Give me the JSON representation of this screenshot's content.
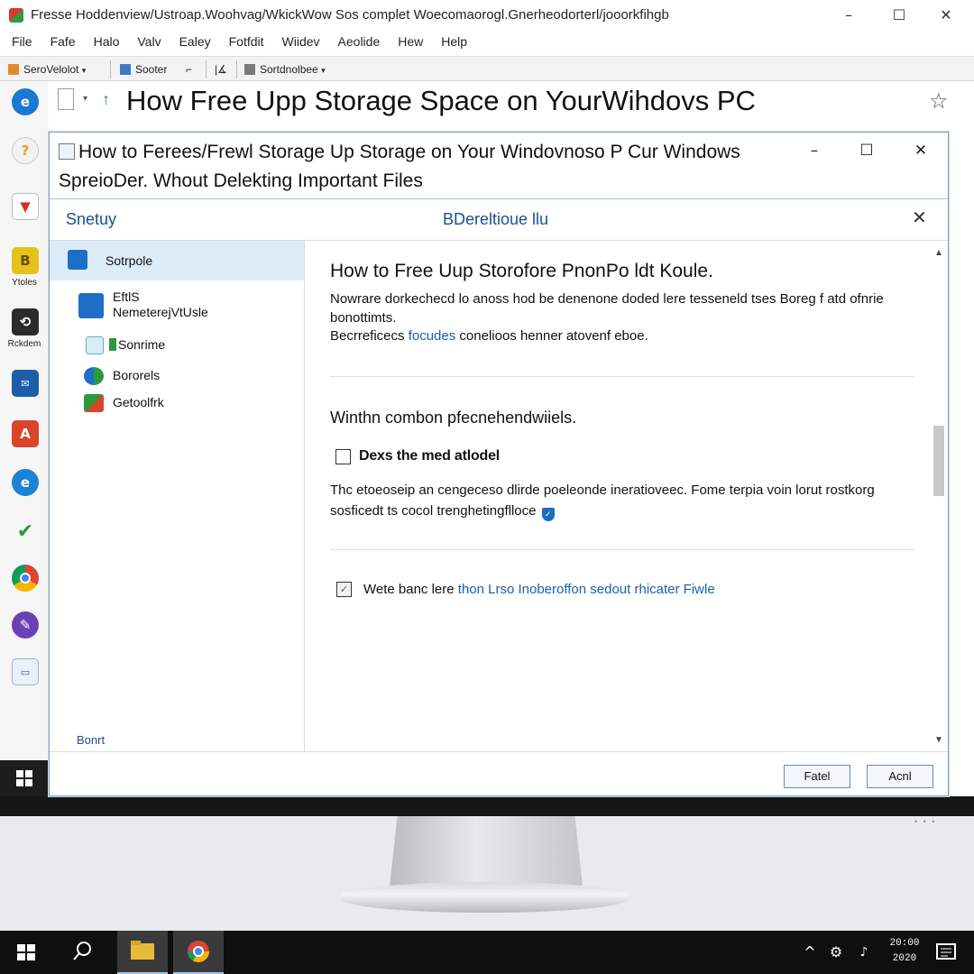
{
  "outer_window": {
    "title": "Fresse Hoddenview/Ustroap.Woohvag/WkickWow Sos complet Woecomaorogl.Gnerheodorterl/jooorkfihgb",
    "menus": [
      "File",
      "Fafe",
      "Halo",
      "Valv",
      "Ealey",
      "Fotfdit",
      "Wiidev",
      "Aeolide",
      "Hew",
      "Help"
    ],
    "toolbar": {
      "btn1": "SeroVelolot",
      "btn2": "Sooter",
      "btn3": "Sortdnolbee"
    },
    "page_heading": "How Free Upp Storage Space on YourWihdovs PC"
  },
  "app_strip": {
    "label1": "Ytoles",
    "label2": "Rckdem"
  },
  "inner_window": {
    "title": "How to Ferees/Frewl Storage Up Storage on  Your Windovnoso P Cur Windows SpreioDer. Whout Delekting Important Files"
  },
  "dialog": {
    "left_title": "Snetuy",
    "center_title": "BDereltioue llu",
    "nav": [
      {
        "label": "Sotrpole"
      },
      {
        "label_line1": "EftlS",
        "label_line2": "NemeterejVtUsle"
      },
      {
        "label": "Sonrime"
      },
      {
        "label": "Bororels"
      },
      {
        "label": "Getoolfrk"
      }
    ],
    "nav_footer": "Bonrt",
    "content": {
      "heading": "How to Free Uup Storofore PnonPo ldt Koule.",
      "para1": "Nowrare dorkechecd lo anoss hod be denenone doded lere tesseneld tses Boreg f atd ofnrie bonottimts.",
      "para2_prefix": "Becrreficecs ",
      "para2_link": "focudes",
      "para2_suffix": " conelioos henner atovenf eboe.",
      "subheading": "Winthn combon pfecnehendwiiels.",
      "checkbox1_label": "Dexs the med atlodel",
      "checkbox1_checked": false,
      "para3": "Thc etoeoseip an cengeceso dlirde poeleonde ineratioveec. Fome terpia voin lorut rostkorg sosficedt ts cocol trenghetingflloce",
      "checkbox2_checked": true,
      "checkbox2_prefix": "Wete banc lere ",
      "checkbox2_link": "thon Lrso Inoberoffon sedout rhicater Fiwle"
    },
    "buttons": {
      "cancel": "Fatel",
      "apply": "Acnl"
    }
  },
  "taskbar": {
    "clock_time": "20:00",
    "clock_date": "2020"
  },
  "colors": {
    "accent_blue": "#1b4f91",
    "link_blue": "#1b5fae",
    "selected_nav": "#dcebf8",
    "window_border": "#7fa3c8",
    "taskbar": "#0f0f10"
  }
}
